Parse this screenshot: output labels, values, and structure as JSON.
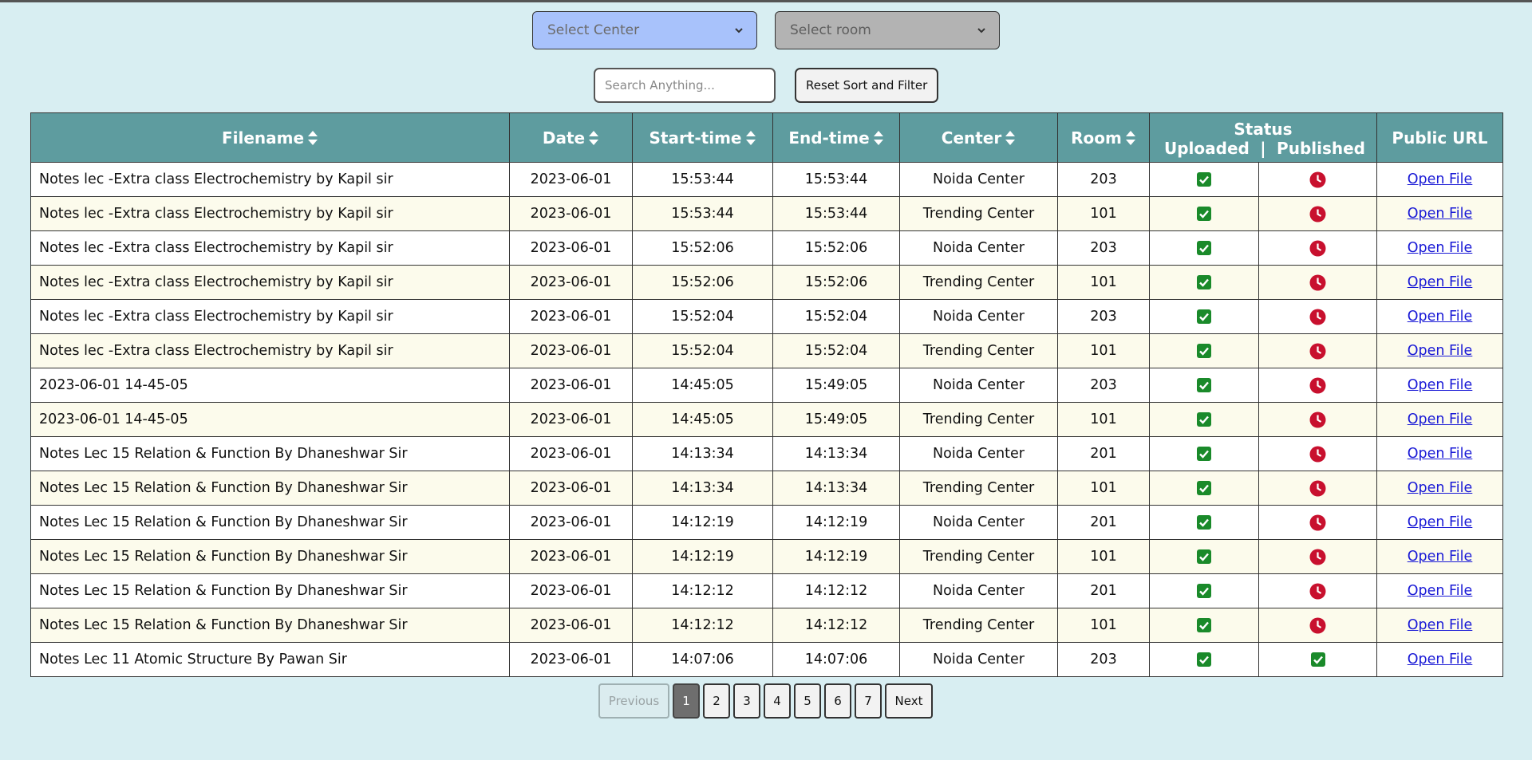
{
  "filters": {
    "center_placeholder": "Select Center",
    "room_placeholder": "Select room",
    "search_placeholder": "Search Anything...",
    "reset_label": "Reset Sort and Filter"
  },
  "table": {
    "headers": {
      "filename": "Filename",
      "date": "Date",
      "start": "Start-time",
      "end": "End-time",
      "center": "Center",
      "room": "Room",
      "status": "Status",
      "uploaded": "Uploaded",
      "divider": "|",
      "published": "Published",
      "url": "Public URL"
    },
    "link_label": "Open File",
    "rows": [
      {
        "filename": "Notes lec -Extra class Electrochemistry by Kapil sir",
        "date": "2023-06-01",
        "start": "15:53:44",
        "end": "15:53:44",
        "center": "Noida Center",
        "room": "203",
        "uploaded": "done",
        "published": "pending"
      },
      {
        "filename": "Notes lec -Extra class Electrochemistry by Kapil sir",
        "date": "2023-06-01",
        "start": "15:53:44",
        "end": "15:53:44",
        "center": "Trending Center",
        "room": "101",
        "uploaded": "done",
        "published": "pending"
      },
      {
        "filename": "Notes lec -Extra class Electrochemistry by Kapil sir",
        "date": "2023-06-01",
        "start": "15:52:06",
        "end": "15:52:06",
        "center": "Noida Center",
        "room": "203",
        "uploaded": "done",
        "published": "pending"
      },
      {
        "filename": "Notes lec -Extra class Electrochemistry by Kapil sir",
        "date": "2023-06-01",
        "start": "15:52:06",
        "end": "15:52:06",
        "center": "Trending Center",
        "room": "101",
        "uploaded": "done",
        "published": "pending"
      },
      {
        "filename": "Notes lec -Extra class Electrochemistry by Kapil sir",
        "date": "2023-06-01",
        "start": "15:52:04",
        "end": "15:52:04",
        "center": "Noida Center",
        "room": "203",
        "uploaded": "done",
        "published": "pending"
      },
      {
        "filename": "Notes lec -Extra class Electrochemistry by Kapil sir",
        "date": "2023-06-01",
        "start": "15:52:04",
        "end": "15:52:04",
        "center": "Trending Center",
        "room": "101",
        "uploaded": "done",
        "published": "pending"
      },
      {
        "filename": "2023-06-01 14-45-05",
        "date": "2023-06-01",
        "start": "14:45:05",
        "end": "15:49:05",
        "center": "Noida Center",
        "room": "203",
        "uploaded": "done",
        "published": "pending"
      },
      {
        "filename": "2023-06-01 14-45-05",
        "date": "2023-06-01",
        "start": "14:45:05",
        "end": "15:49:05",
        "center": "Trending Center",
        "room": "101",
        "uploaded": "done",
        "published": "pending"
      },
      {
        "filename": "Notes Lec 15 Relation & Function By Dhaneshwar Sir",
        "date": "2023-06-01",
        "start": "14:13:34",
        "end": "14:13:34",
        "center": "Noida Center",
        "room": "201",
        "uploaded": "done",
        "published": "pending"
      },
      {
        "filename": "Notes Lec 15 Relation & Function By Dhaneshwar Sir",
        "date": "2023-06-01",
        "start": "14:13:34",
        "end": "14:13:34",
        "center": "Trending Center",
        "room": "101",
        "uploaded": "done",
        "published": "pending"
      },
      {
        "filename": "Notes Lec 15 Relation & Function By Dhaneshwar Sir",
        "date": "2023-06-01",
        "start": "14:12:19",
        "end": "14:12:19",
        "center": "Noida Center",
        "room": "201",
        "uploaded": "done",
        "published": "pending"
      },
      {
        "filename": "Notes Lec 15 Relation & Function By Dhaneshwar Sir",
        "date": "2023-06-01",
        "start": "14:12:19",
        "end": "14:12:19",
        "center": "Trending Center",
        "room": "101",
        "uploaded": "done",
        "published": "pending"
      },
      {
        "filename": "Notes Lec 15 Relation & Function By Dhaneshwar Sir",
        "date": "2023-06-01",
        "start": "14:12:12",
        "end": "14:12:12",
        "center": "Noida Center",
        "room": "201",
        "uploaded": "done",
        "published": "pending"
      },
      {
        "filename": "Notes Lec 15 Relation & Function By Dhaneshwar Sir",
        "date": "2023-06-01",
        "start": "14:12:12",
        "end": "14:12:12",
        "center": "Trending Center",
        "room": "101",
        "uploaded": "done",
        "published": "pending"
      },
      {
        "filename": "Notes Lec 11 Atomic Structure By Pawan Sir",
        "date": "2023-06-01",
        "start": "14:07:06",
        "end": "14:07:06",
        "center": "Noida Center",
        "room": "203",
        "uploaded": "done",
        "published": "done"
      }
    ]
  },
  "pagination": {
    "previous": "Previous",
    "next": "Next",
    "pages": [
      "1",
      "2",
      "3",
      "4",
      "5",
      "6",
      "7"
    ],
    "current": "1"
  },
  "colors": {
    "page_bg": "#d8eef2",
    "header_bg": "#5e9c9f",
    "status_done": "#1a8a2a",
    "status_pending": "#c8102e",
    "link": "#1a1ad6"
  },
  "icons": {
    "sort": "sort-icon",
    "uploaded_done": "check-square-icon",
    "published_pending": "clock-icon",
    "published_done": "check-square-icon",
    "dropdown": "chevron-down-icon"
  }
}
